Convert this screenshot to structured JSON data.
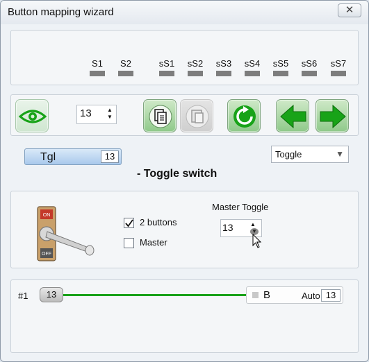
{
  "window": {
    "title": "Button mapping wizard",
    "close_glyph": "✕"
  },
  "switches": {
    "labels": [
      "S1",
      "S2",
      "sS1",
      "sS2",
      "sS3",
      "sS4",
      "sS5",
      "sS6",
      "sS7"
    ]
  },
  "toolbar": {
    "view_icon": "eye-icon",
    "button_number": "13",
    "copy_icon": "copy-icon",
    "paste_icon": "paste-icon",
    "refresh_icon": "refresh-icon",
    "prev_icon": "arrow-left-icon",
    "next_icon": "arrow-right-icon",
    "accent": "#18a318"
  },
  "mode": {
    "short_label": "Tgl",
    "button_number": "13",
    "type_selected": "Toggle",
    "description": "- Toggle switch"
  },
  "options": {
    "two_buttons_label": "2 buttons",
    "two_buttons_checked": true,
    "master_label": "Master",
    "master_checked": false,
    "master_toggle_label": "Master Toggle",
    "master_toggle_value": "13",
    "switch_labels": {
      "on": "ON",
      "off": "OFF"
    }
  },
  "mapping": {
    "row_label": "#1",
    "input_button": "13",
    "output_label": "B",
    "auto_label": "Auto",
    "auto_value": "13",
    "line_color": "#19a119"
  }
}
